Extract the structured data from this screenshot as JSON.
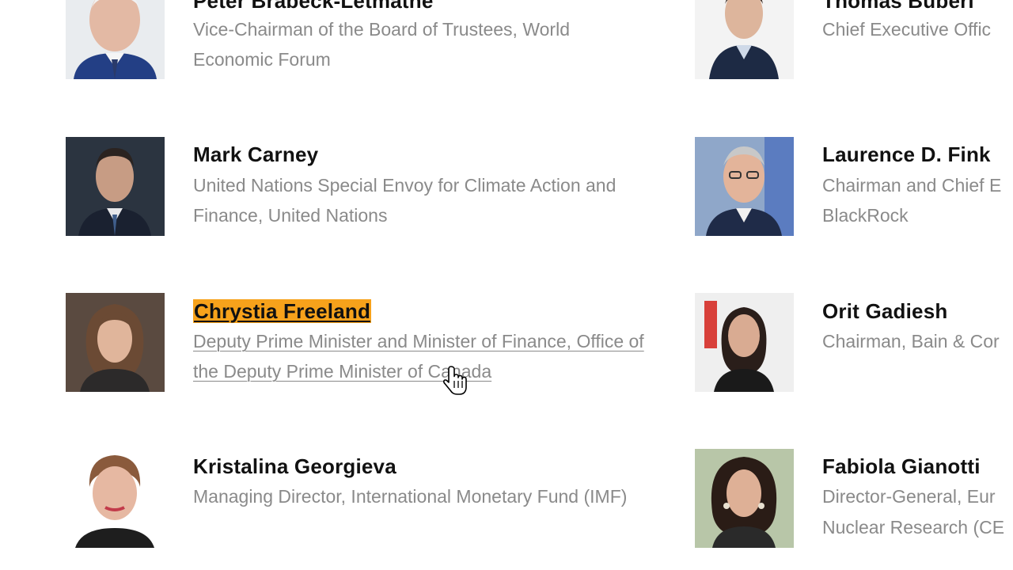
{
  "people": [
    {
      "name": "Peter Brabeck-Letmathe",
      "role": "Vice-Chairman of the Board of Trustees, World Economic Forum"
    },
    {
      "name": "Thomas Buberl",
      "role": "Chief Executive Offic"
    },
    {
      "name": "Mark Carney",
      "role": "United Nations Special Envoy for Climate Action and Finance, United Nations"
    },
    {
      "name": "Laurence D. Fink",
      "role_line1": "Chairman and Chief E",
      "role_line2": "BlackRock"
    },
    {
      "name": "Chrystia Freeland",
      "role": "Deputy Prime Minister and Minister of Finance, Office of the Deputy Prime Minister of Canada"
    },
    {
      "name": "Orit Gadiesh",
      "role": "Chairman, Bain & Cor"
    },
    {
      "name": "Kristalina Georgieva",
      "role": "Managing Director, International Monetary Fund (IMF)"
    },
    {
      "name": "Fabiola Gianotti",
      "role_line1": "Director-General, Eur",
      "role_line2": "Nuclear Research (CE"
    }
  ],
  "colors": {
    "highlight": "#f7a21b",
    "name_text": "#111111",
    "role_text": "#8a8a8a"
  },
  "icons": {
    "cursor": "hand-pointer-cursor-icon"
  }
}
